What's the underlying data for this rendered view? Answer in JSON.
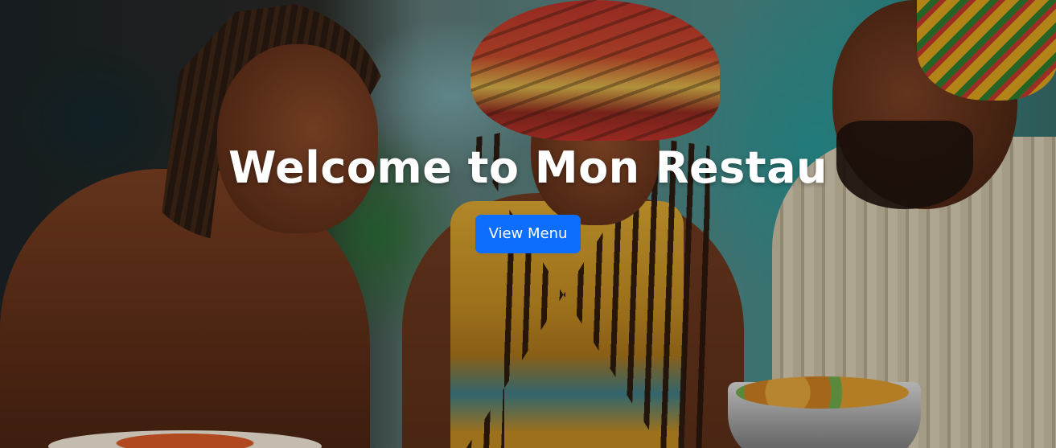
{
  "hero": {
    "title": "Welcome to Mon Restau",
    "cta_label": "View Menu",
    "photo": "people-laughing-at-meal-photo"
  },
  "colors": {
    "button_primary": "#0d6efd",
    "title_text": "#ffffff"
  }
}
